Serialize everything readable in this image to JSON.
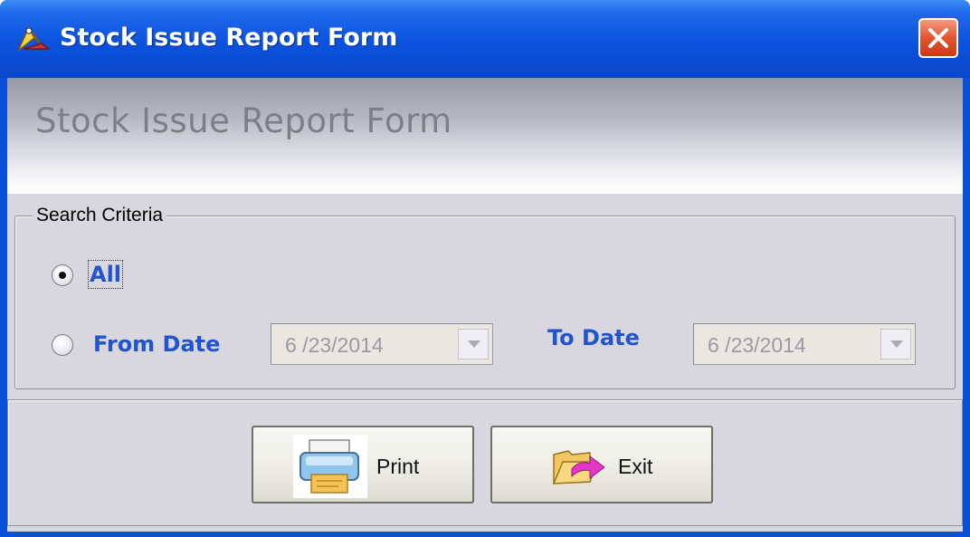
{
  "window": {
    "title": "Stock Issue Report Form"
  },
  "header": {
    "title": "Stock Issue Report Form"
  },
  "search_criteria": {
    "group_label": "Search Criteria",
    "selected": "All",
    "options": [
      {
        "label": "All",
        "checked": true
      },
      {
        "label": "From Date",
        "checked": false
      }
    ],
    "to_label": "To Date",
    "from_date": "6 /23/2014",
    "to_date": "6 /23/2014"
  },
  "buttons": {
    "print_label": "Print",
    "exit_label": "Exit"
  },
  "icons": {
    "app": "app-icon",
    "close": "close-icon",
    "print": "printer-icon",
    "exit": "exit-folder-icon",
    "dropdown": "chevron-down-icon"
  },
  "colors": {
    "titlebar": "#0a52de",
    "label_blue": "#2255cc",
    "close_red": "#e3542e",
    "form_bg": "#d8d6df"
  }
}
